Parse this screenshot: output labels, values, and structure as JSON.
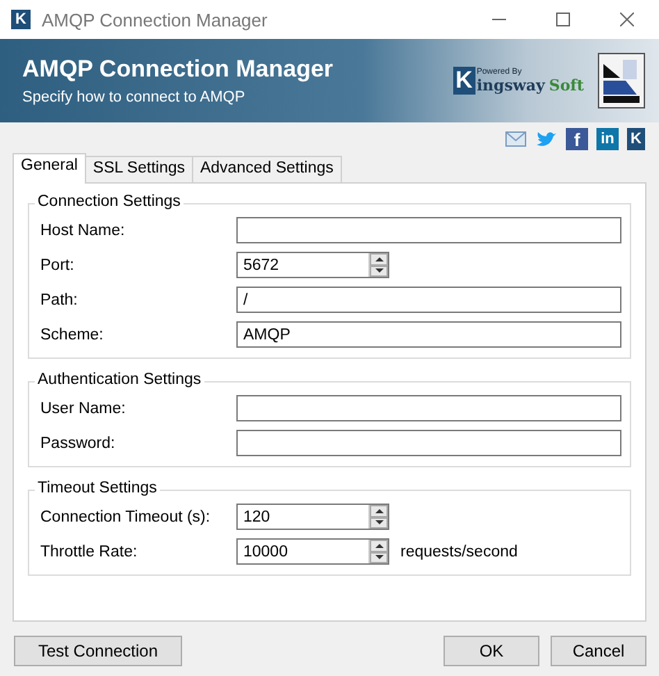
{
  "window": {
    "title": "AMQP Connection Manager",
    "icon_glyph": "K"
  },
  "banner": {
    "title": "AMQP Connection Manager",
    "subtitle": "Specify how to connect to AMQP",
    "logo": {
      "caption": "Powered By",
      "initial": "K",
      "word": "ingsway",
      "suffix": "Soft"
    }
  },
  "share_icons": [
    {
      "kind": "mail"
    },
    {
      "kind": "twitter"
    },
    {
      "kind": "facebook",
      "glyph": "f"
    },
    {
      "kind": "linkedin",
      "glyph": "in"
    },
    {
      "kind": "brand",
      "glyph": "K"
    }
  ],
  "tabs": [
    {
      "label": "General",
      "selected": true
    },
    {
      "label": "SSL Settings",
      "selected": false
    },
    {
      "label": "Advanced Settings",
      "selected": false
    }
  ],
  "groups": [
    {
      "title": "Connection Settings",
      "fields": [
        {
          "label": "Host Name:",
          "kind": "text"
        },
        {
          "label": "Port:",
          "kind": "spinner",
          "value": "5672"
        },
        {
          "label": "Path:",
          "kind": "text",
          "value": "/"
        },
        {
          "label": "Scheme:",
          "kind": "text",
          "value": "AMQP"
        }
      ]
    },
    {
      "title": "Authentication Settings",
      "fields": [
        {
          "label": "User Name:",
          "kind": "text"
        },
        {
          "label": "Password:",
          "kind": "text"
        }
      ]
    },
    {
      "title": "Timeout Settings",
      "fields": [
        {
          "label": "Connection Timeout (s):",
          "kind": "spinner",
          "value": "120"
        },
        {
          "label": "Throttle Rate:",
          "kind": "spinner",
          "value": "10000",
          "unit": "requests/second"
        }
      ]
    }
  ],
  "buttons": {
    "left": [
      "Test Connection"
    ],
    "right": [
      "OK",
      "Cancel"
    ]
  }
}
